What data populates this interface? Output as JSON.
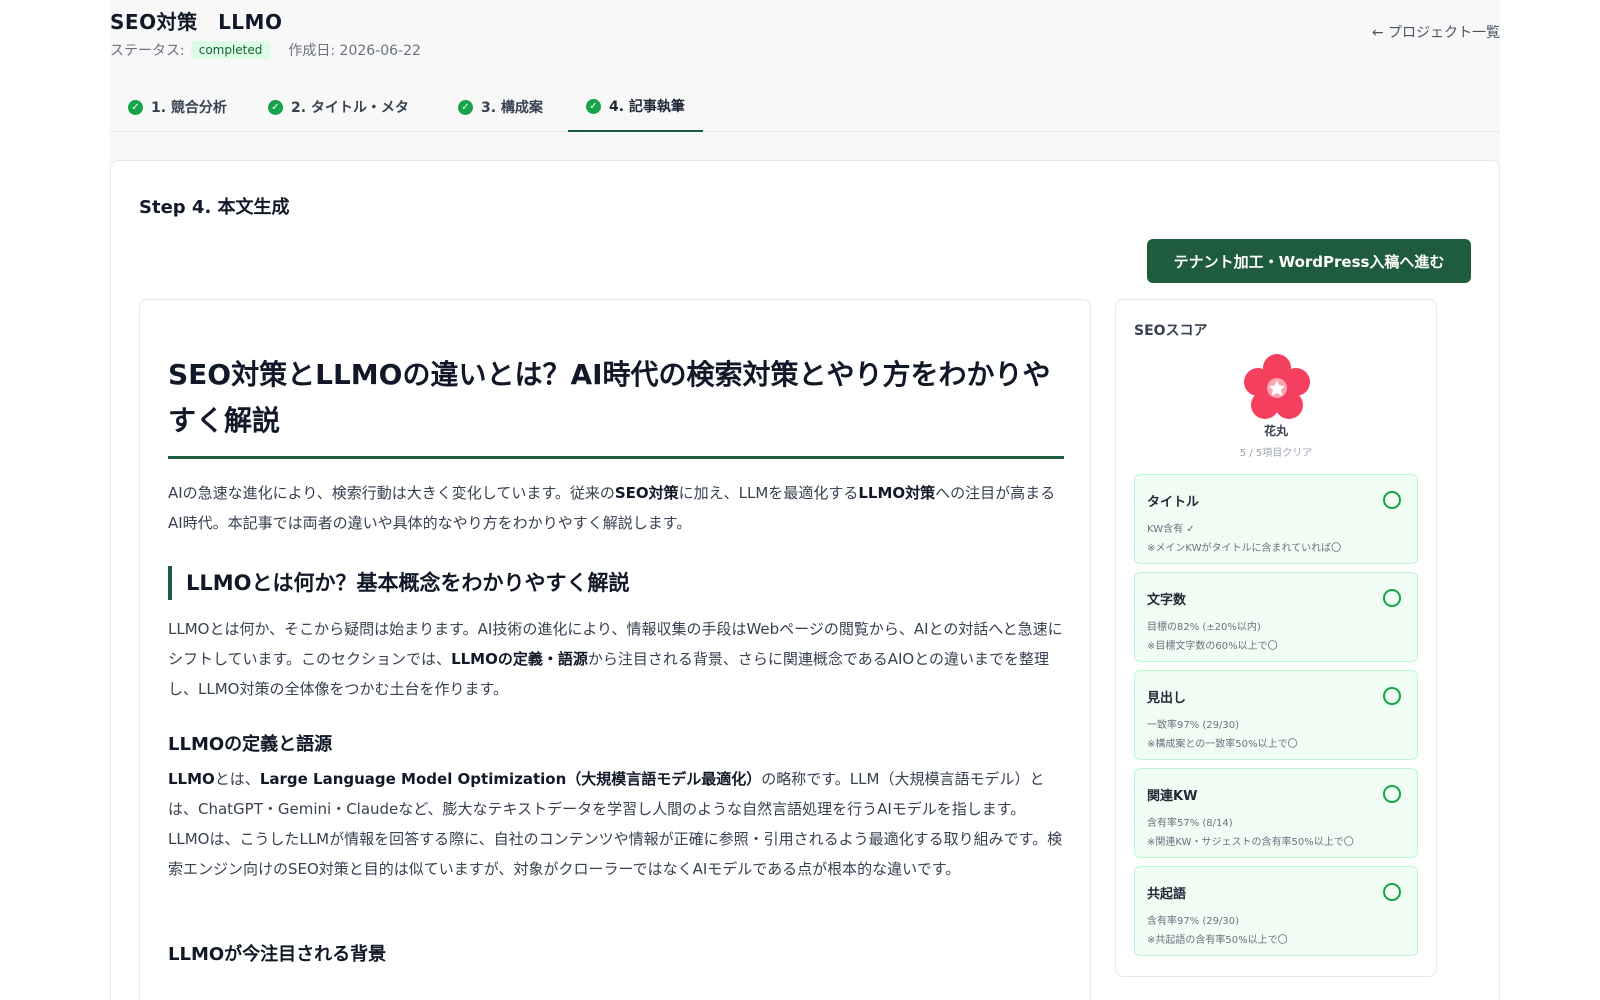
{
  "project": {
    "title": "SEO対策　LLMO",
    "status_label": "ステータス:",
    "status_value": "completed",
    "created": "作成日: 2026-06-22",
    "back_link": "← プロジェクト一覧"
  },
  "tabs": [
    {
      "label": "1. 競合分析",
      "done": true
    },
    {
      "label": "2. タイトル・メタ",
      "done": true
    },
    {
      "label": "3. 構成案",
      "done": true
    },
    {
      "label": "4. 記事執筆",
      "done": true,
      "active": true
    }
  ],
  "step": {
    "title": "Step 4. 本文生成",
    "proceed_button": "テナント加工・WordPress入稿へ進む"
  },
  "article": {
    "h1": "SEO対策とLLMOの違いとは？AI時代の検索対策とやり方をわかりやすく解説",
    "intro": {
      "a": "AIの急速な進化により、検索行動は大きく変化しています。従来の",
      "b1": "SEO対策",
      "c": "に加え、LLMを最適化する",
      "b2": "LLMO対策",
      "d": "への注目が高まるAI時代。本記事では両者の違いや具体的なやり方をわかりやすく解説します。"
    },
    "h2": "LLMOとは何か？基本概念をわかりやすく解説",
    "p2": {
      "a": "LLMOとは何か、そこから疑問は始まります。AI技術の進化により、情報収集の手段はWebページの閲覧から、AIとの対話へと急速にシフトしています。このセクションでは、",
      "b": "LLMOの定義・語源",
      "c": "から注目される背景、さらに関連概念であるAIOとの違いまでを整理し、LLMO対策の全体像をつかむ土台を作ります。"
    },
    "h3_1": "LLMOの定義と語源",
    "p3": {
      "b1": "LLMO",
      "a": "とは、",
      "b2": "Large Language Model Optimization（大規模言語モデル最適化）",
      "c": "の略称です。LLM（大規模言語モデル）とは、ChatGPT・Gemini・Claudeなど、膨大なテキストデータを学習し人間のような自然言語処理を行うAIモデルを指します。LLMOは、こうしたLLMが情報を回答する際に、自社のコンテンツや情報が正確に参照・引用されるよう最適化する取り組みです。検索エンジン向けのSEO対策と目的は似ていますが、対象がクローラーではなくAIモデルである点が根本的な違いです。"
    },
    "h3_2": "LLMOが今注目される背景"
  },
  "score": {
    "title": "SEOスコア",
    "rank_name": "花丸",
    "clear_text": "5 / 5項目クリア",
    "items": [
      {
        "title": "タイトル",
        "line1": "KW含有 ✓",
        "line2": "※メインKWがタイトルに含まれていれば〇"
      },
      {
        "title": "文字数",
        "line1": "目標の82% (±20%以内)",
        "line2": "※目標文字数の60%以上で〇"
      },
      {
        "title": "見出し",
        "line1": "一致率97% (29/30)",
        "line2": "※構成案との一致率50%以上で〇"
      },
      {
        "title": "関連KW",
        "line1": "含有率57% (8/14)",
        "line2": "※関連KW・サジェストの含有率50%以上で〇"
      },
      {
        "title": "共起語",
        "line1": "含有率97% (29/30)",
        "line2": "※共起語の含有率50%以上で〇"
      }
    ]
  },
  "colors": {
    "brand": "#1f5c3e",
    "success": "#16a34a",
    "flower": "#f43f5e"
  }
}
